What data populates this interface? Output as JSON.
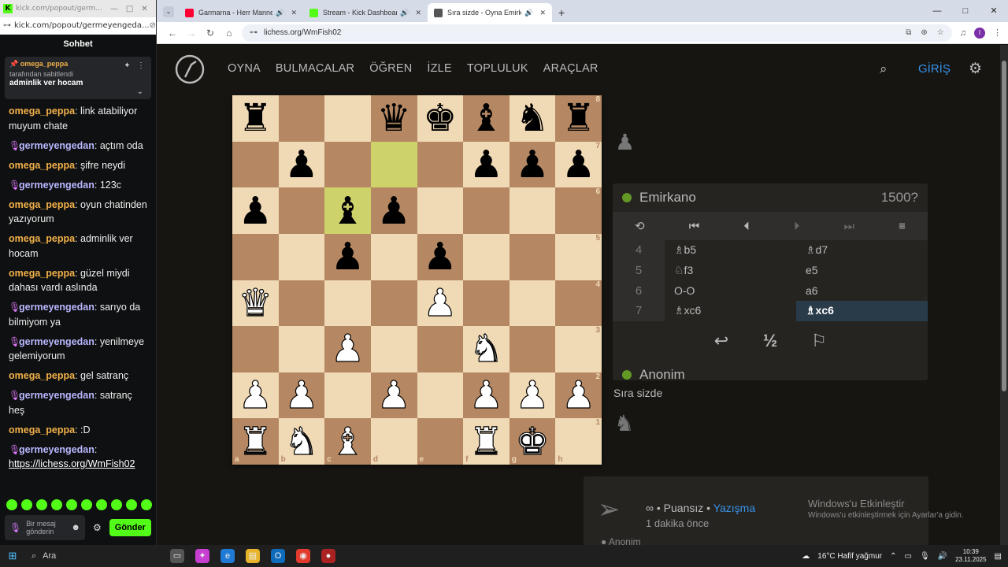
{
  "kick": {
    "window_url_short": "kick.com/popout/germ...",
    "url": "kick.com/popout/germeyengeda...",
    "chat_title": "Sohbet",
    "pinned": {
      "user": "omega_peppa",
      "pinned_by": "tarafından sabitlendi",
      "message": "adminlik ver hocam"
    },
    "messages": [
      {
        "user": "omega_peppa",
        "type": "u1",
        "text": ": link atabiliyor muyum chate"
      },
      {
        "user": "germeyengedan",
        "type": "u2",
        "text": ": açtım oda"
      },
      {
        "user": "omega_peppa",
        "type": "u1",
        "text": ": şifre neydi"
      },
      {
        "user": "germeyengedan",
        "type": "u2",
        "text": ": 123c"
      },
      {
        "user": "omega_peppa",
        "type": "u1",
        "text": ": oyun chatinden yazıyorum"
      },
      {
        "user": "omega_peppa",
        "type": "u1",
        "text": ": adminlik ver hocam"
      },
      {
        "user": "omega_peppa",
        "type": "u1",
        "text": ": güzel miydi dahası vardı aslında"
      },
      {
        "user": "germeyengedan",
        "type": "u2",
        "text": ": sarıyo da bilmiyom ya"
      },
      {
        "user": "germeyengedan",
        "type": "u2",
        "text": ": yenilmeye gelemiyorum"
      },
      {
        "user": "omega_peppa",
        "type": "u1",
        "text": ": gel satranç"
      },
      {
        "user": "germeyengedan",
        "type": "u2",
        "text": ": satranç heş"
      },
      {
        "user": "omega_peppa",
        "type": "u1",
        "text": ": :D"
      },
      {
        "user": "germeyengedan",
        "type": "u2",
        "text": ":",
        "link": "https://lichess.org/WmFish02"
      }
    ],
    "input_placeholder": "Bir mesaj gönderin",
    "send_label": "Gönder"
  },
  "browser": {
    "tabs": [
      {
        "title": "Garmarna - Herr Mannelig",
        "favicon_color": "#ff0033",
        "active": false
      },
      {
        "title": "Stream - Kick Dashboard",
        "favicon_color": "#53fc18",
        "active": false
      },
      {
        "title": "Sıra sizde - Oyna Emirkano",
        "favicon_color": "#555555",
        "active": true
      }
    ],
    "url": "lichess.org/WmFish02"
  },
  "lichess": {
    "nav": [
      "OYNA",
      "BULMACALAR",
      "ÖĞREN",
      "İZLE",
      "TOPLULUK",
      "ARAÇLAR"
    ],
    "login": "GİRİŞ",
    "top_player": {
      "name": "Emirkano",
      "rating": "1500?"
    },
    "bottom_player": {
      "name": "Anonim"
    },
    "moves": [
      {
        "n": "4",
        "w": "♗b5",
        "b": "♗d7"
      },
      {
        "n": "5",
        "w": "♘f3",
        "b": "e5"
      },
      {
        "n": "6",
        "w": "O-O",
        "b": "a6"
      },
      {
        "n": "7",
        "w": "♗xc6",
        "b": "♗xc6"
      }
    ],
    "turn_text": "Sıra sizde",
    "correspondence": {
      "mode": "∞ • Puansız •",
      "mode_link": "Yazışma",
      "time": "1 dakika önce",
      "player": "Anonim"
    },
    "board": [
      [
        "r",
        "",
        "",
        "q",
        "k",
        "b",
        "n",
        "r"
      ],
      [
        "",
        "p",
        "",
        "",
        "",
        "p",
        "p",
        "p"
      ],
      [
        "p",
        "",
        "b",
        "p",
        "",
        "",
        "",
        ""
      ],
      [
        "",
        "",
        "p",
        "",
        "p",
        "",
        "",
        ""
      ],
      [
        "Q",
        "",
        "",
        "",
        "P",
        "",
        "",
        ""
      ],
      [
        "",
        "",
        "P",
        "",
        "",
        "N",
        "",
        ""
      ],
      [
        "P",
        "P",
        "",
        "P",
        "",
        "P",
        "P",
        "P"
      ],
      [
        "R",
        "N",
        "B",
        "",
        "",
        "R",
        "K",
        ""
      ]
    ],
    "last_move_squares": [
      "d7",
      "c6"
    ],
    "ranks": [
      "8",
      "7",
      "6",
      "5",
      "4",
      "3",
      "2",
      "1"
    ],
    "files": [
      "a",
      "b",
      "c",
      "d",
      "e",
      "f",
      "g",
      "h"
    ]
  },
  "windows_activation": {
    "title": "Windows'u Etkinleştir",
    "subtitle": "Windows'u etkinleştirmek için Ayarlar'a gidin."
  },
  "taskbar": {
    "search": "Ara",
    "weather": "16°C  Hafif yağmur",
    "time": "10:39",
    "date": "23.11.2025"
  }
}
